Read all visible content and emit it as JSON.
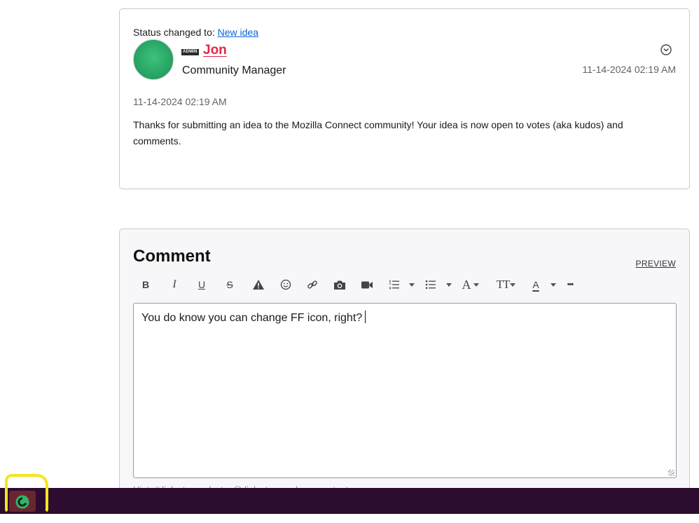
{
  "status": {
    "prefix": "Status changed to: ",
    "value": "New idea"
  },
  "post": {
    "badge": "ADMIN",
    "author": "Jon",
    "role": "Community Manager",
    "header_time": "11-14-2024 02:19 AM",
    "body_time": "11-14-2024 02:19 AM",
    "body": "Thanks for submitting an idea to the Mozilla Connect community! Your idea is now open to votes (aka kudos) and comments."
  },
  "comment": {
    "title": "Comment",
    "preview_label": "PREVIEW",
    "editor_text": "You do know you can change FF icon, right?",
    "hint": "Hint: # links to products, @ links to members, content"
  },
  "toolbar": {
    "bold": "B",
    "italic": "I",
    "underline": "U",
    "strike": "S",
    "font": "A",
    "size": "TT",
    "color": "A",
    "more": "•••"
  },
  "colors": {
    "link": "#0a64d8",
    "author": "#e0284a",
    "taskbar": "#2c0d2f",
    "highlight": "#f6e51f"
  },
  "icons": [
    "chevron-down-circle-icon",
    "warning-icon",
    "emoji-icon",
    "link-icon",
    "camera-icon",
    "video-icon",
    "ordered-list-icon",
    "bullet-list-icon",
    "ellipsis-icon",
    "firefox-icon"
  ]
}
